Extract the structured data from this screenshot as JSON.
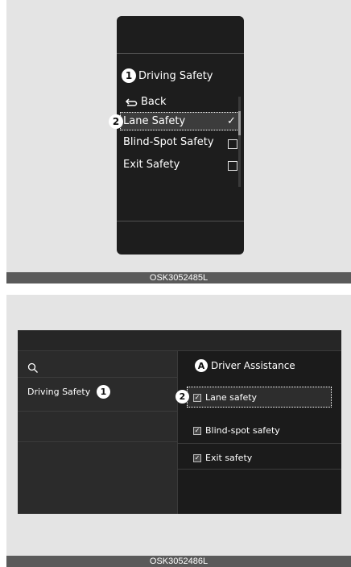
{
  "figure1": {
    "badge_1": "1",
    "badge_2": "2",
    "title": "Driving Safety",
    "back_label": "Back",
    "items": [
      {
        "label": "Lane Safety",
        "checked": true
      },
      {
        "label": "Blind-Spot Safety",
        "checked": false
      },
      {
        "label": "Exit Safety",
        "checked": false
      }
    ],
    "caption": "OSK3052485L"
  },
  "figure2": {
    "badge_a": "A",
    "badge_1": "1",
    "badge_2": "2",
    "heading": "Driver Assistance",
    "left_item": "Driving Safety",
    "options": [
      {
        "label": "Lane safety",
        "checked": true
      },
      {
        "label": "Blind-spot safety",
        "checked": true
      },
      {
        "label": "Exit safety",
        "checked": true
      }
    ],
    "check_glyph": "✓",
    "caption": "OSK3052486L"
  },
  "colors": {
    "panel": "#1d1d1d",
    "figure_bg": "#e4e4e4",
    "caption_bar": "#5a5a5a"
  }
}
